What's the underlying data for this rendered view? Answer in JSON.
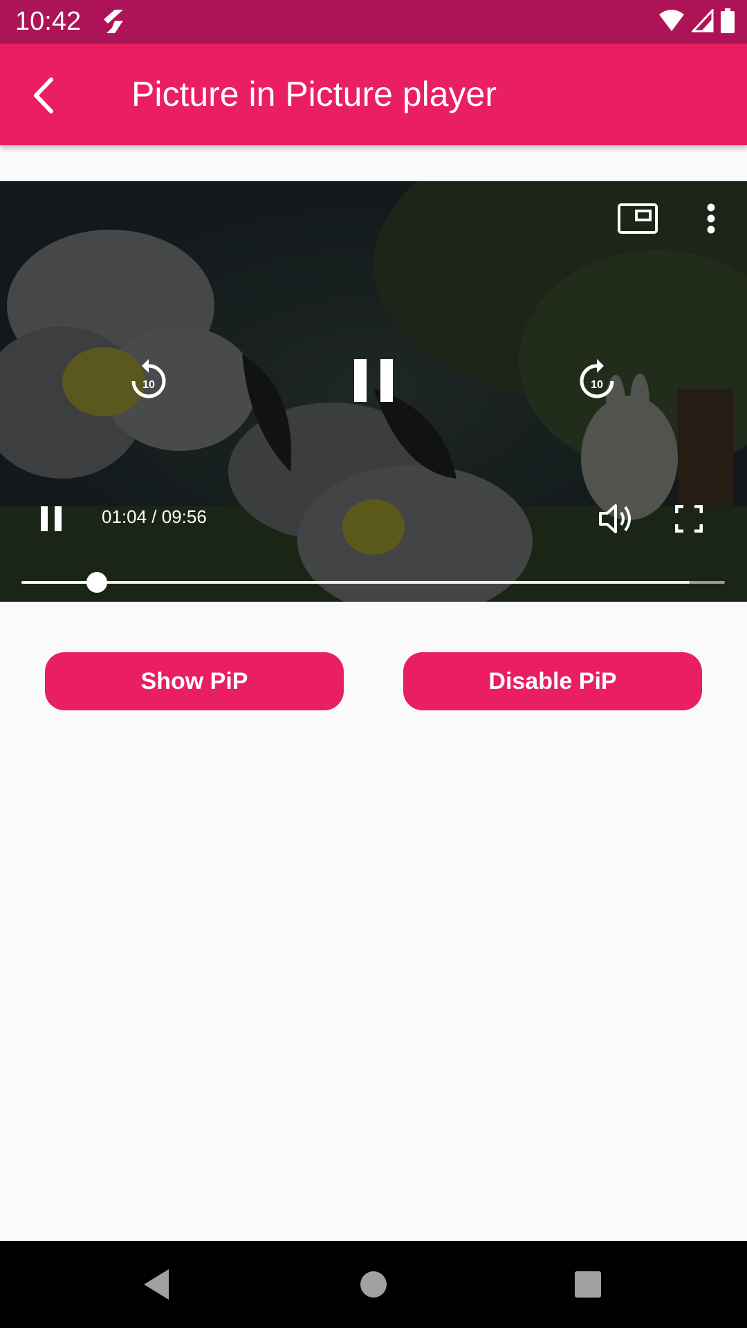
{
  "status_bar": {
    "time": "10:42",
    "icons": [
      "flutter-icon",
      "wifi-icon",
      "signal-icon",
      "battery-icon"
    ]
  },
  "app_bar": {
    "title": "Picture in Picture player",
    "back_icon": "back-arrow-icon",
    "color": "#e91e63"
  },
  "player": {
    "time_display": "01:04 / 09:56",
    "progress_fraction": 0.107,
    "buffered_fraction": 0.95,
    "top_controls": [
      "pip-icon",
      "more-vert-icon"
    ],
    "center_controls": [
      "replay-10-icon",
      "pause-icon",
      "forward-10-icon"
    ],
    "bottom_controls": [
      "pause-icon",
      "volume-icon",
      "fullscreen-icon"
    ],
    "replay_label": "10",
    "forward_label": "10"
  },
  "buttons": {
    "show_pip": "Show PiP",
    "disable_pip": "Disable PiP"
  },
  "colors": {
    "status_bar": "#ad1457",
    "accent": "#e91e63",
    "background": "#fafafa"
  }
}
